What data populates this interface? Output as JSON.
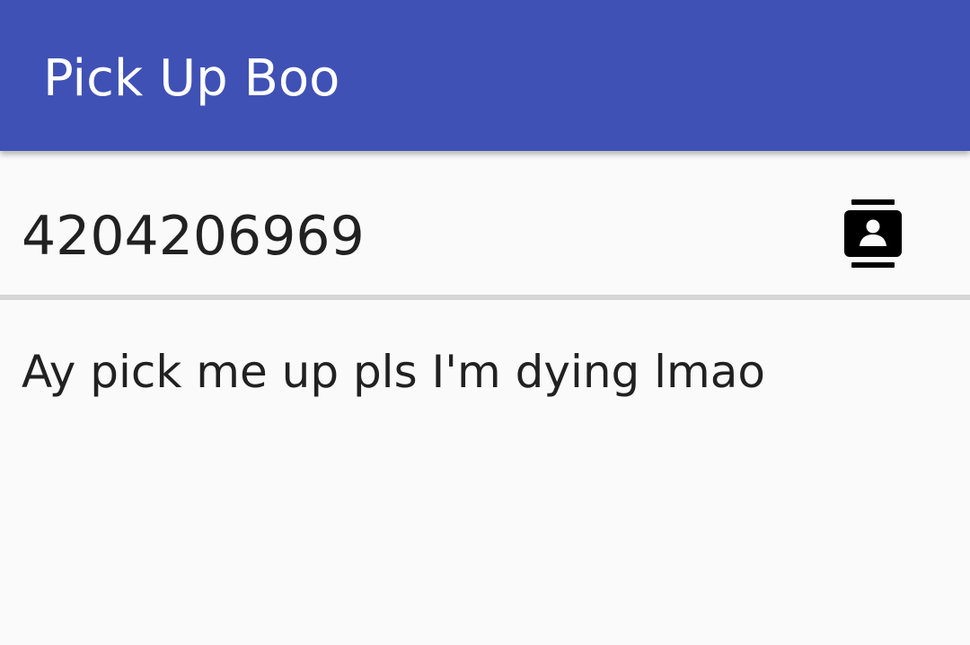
{
  "app_bar": {
    "title": "Pick Up Boo",
    "color": "#3f51b5"
  },
  "phone": {
    "value": "4204206969"
  },
  "contacts_button": {
    "icon": "contacts-icon"
  },
  "message": {
    "value": "Ay pick me up pls I'm dying lmao"
  }
}
